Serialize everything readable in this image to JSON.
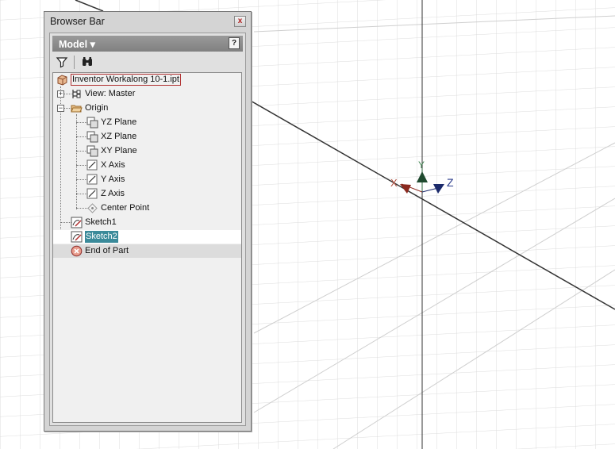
{
  "panel": {
    "title": "Browser Bar",
    "close_glyph": "x",
    "model_label": "Model ▾",
    "help_glyph": "?",
    "toolbar": {
      "filter_icon": "filter-icon",
      "find_icon": "binoculars-icon"
    }
  },
  "tree": {
    "root": "Inventor Workalong 10-1.ipt",
    "view": "View: Master",
    "origin": "Origin",
    "origin_children": [
      "YZ Plane",
      "XZ Plane",
      "XY Plane",
      "X Axis",
      "Y Axis",
      "Z Axis",
      "Center Point"
    ],
    "sketch1": "Sketch1",
    "sketch2": "Sketch2",
    "end_of_part": "End of Part"
  },
  "triad": {
    "x_label": "X",
    "y_label": "Y",
    "z_label": "Z"
  },
  "colors": {
    "x_axis": "#8b2a1f",
    "y_axis": "#1f4a2f",
    "z_axis": "#1b2a6b",
    "selection": "#3a8a9a"
  }
}
